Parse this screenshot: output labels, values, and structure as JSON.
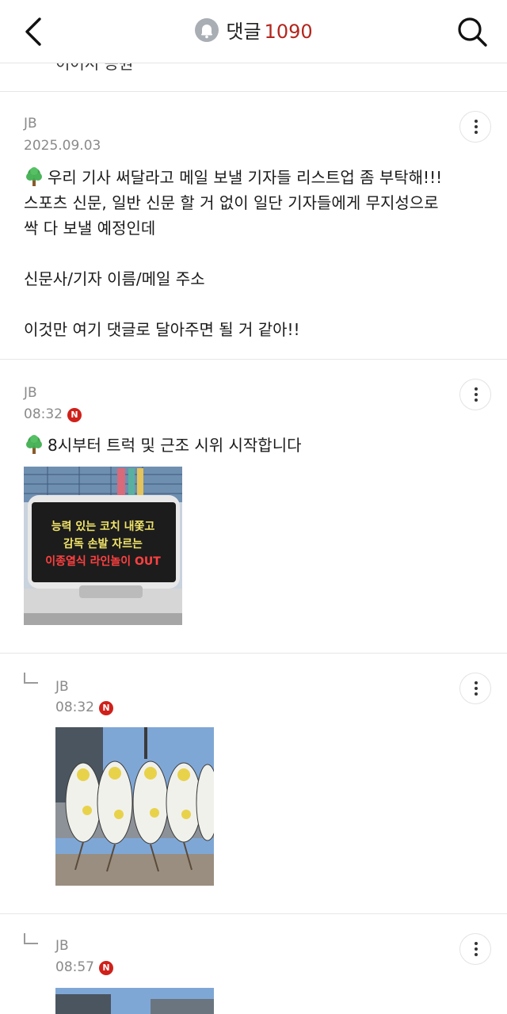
{
  "header": {
    "title_label": "댓글",
    "comment_count": "1090",
    "count_color": "#b3261e",
    "back_icon": "chevron-left-icon",
    "bell_icon": "bell-icon",
    "search_icon": "search-icon"
  },
  "previous_comment_partial": "이어서 공원",
  "comments": [
    {
      "author": "JB",
      "date": "2025.09.03",
      "text": "우리 기사 써달라고 메일 보낼 기자들 리스트업 좀 부탁해!!!\n스포츠 신문, 일반 신문 할 거 없이 일단 기자들에게 무지성으로\n싹 다 보낼 예정인데\n\n신문사/기자 이름/메일 주소\n\n이것만 여기 댓글로 달아주면 될 거 같아!!"
    },
    {
      "author": "JB",
      "date": "08:32",
      "new_badge": "N",
      "text": "8시부터 트럭 및 근조 시위 시작합니다",
      "photo": {
        "description_icon": "truck-led-sign-photo",
        "sign_lines": [
          "능력 있는 코치 내쫓고",
          "감독 손발 자르는",
          "이종열식 라인놀이 OUT"
        ]
      }
    },
    {
      "author": "JB",
      "date": "08:32",
      "new_badge": "N",
      "is_reply": true,
      "photo": {
        "description_icon": "funeral-wreaths-photo"
      }
    },
    {
      "author": "JB",
      "date": "08:57",
      "new_badge": "N",
      "is_reply": true,
      "photo": {
        "description_icon": "building-photo"
      }
    }
  ]
}
